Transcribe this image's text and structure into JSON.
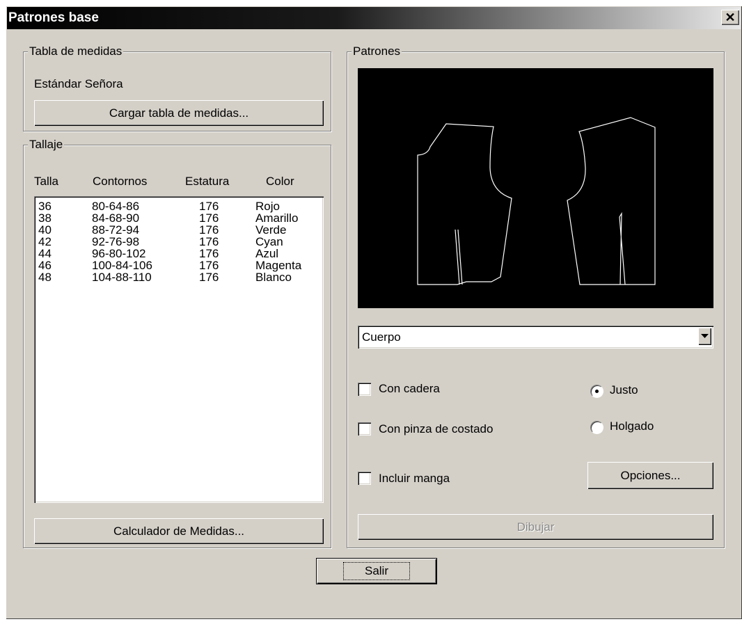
{
  "window": {
    "title": "Patrones base",
    "close_icon": "✕"
  },
  "medidas": {
    "legend": "Tabla de medidas",
    "current": "Estándar Señora",
    "load_button": "Cargar tabla de medidas..."
  },
  "tallaje": {
    "legend": "Tallaje",
    "headers": [
      "Talla",
      "Contornos",
      "Estatura",
      "Color"
    ],
    "rows": [
      [
        "36",
        "80-64-86",
        "176",
        "Rojo"
      ],
      [
        "38",
        "84-68-90",
        "176",
        "Amarillo"
      ],
      [
        "40",
        "88-72-94",
        "176",
        "Verde"
      ],
      [
        "42",
        "92-76-98",
        "176",
        "Cyan"
      ],
      [
        "44",
        "96-80-102",
        "176",
        "Azul"
      ],
      [
        "46",
        "100-84-106",
        "176",
        "Magenta"
      ],
      [
        "48",
        "104-88-110",
        "176",
        "Blanco"
      ]
    ],
    "calc_button": "Calculador de Medidas..."
  },
  "patrones": {
    "legend": "Patrones",
    "combo_value": "Cuerpo",
    "checkboxes": [
      {
        "label": "Con cadera",
        "checked": false
      },
      {
        "label": "Con pinza de costado",
        "checked": false
      },
      {
        "label": "Incluir manga",
        "checked": false
      }
    ],
    "radios": [
      {
        "label": "Justo",
        "selected": true
      },
      {
        "label": "Holgado",
        "selected": false
      }
    ],
    "options_button": "Opciones...",
    "draw_button": "Dibujar"
  },
  "exit_button": "Salir"
}
